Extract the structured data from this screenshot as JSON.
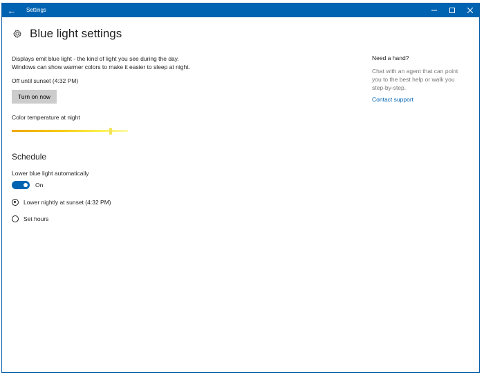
{
  "window": {
    "title": "Settings",
    "back_icon": "arrow-left-icon",
    "controls": [
      "minimize-icon",
      "maximize-icon",
      "close-icon"
    ]
  },
  "header": {
    "icon": "gear-icon",
    "title": "Blue light settings"
  },
  "main": {
    "description": "Displays emit blue light - the kind of light you see during the day. Windows can show warmer colors to make it easier to sleep at night.",
    "status": "Off until sunset (4:32 PM)",
    "turn_on_button": "Turn on now",
    "color_temperature_label": "Color temperature at night",
    "color_temperature_level": 0.85,
    "schedule": {
      "title": "Schedule",
      "auto_label": "Lower blue light automatically",
      "toggle_state": "On",
      "toggle_on": true,
      "options": [
        {
          "label": "Lower nightly at sunset (4:32 PM)",
          "selected": true
        },
        {
          "label": "Set hours",
          "selected": false
        }
      ]
    }
  },
  "help": {
    "title": "Need a hand?",
    "text": "Chat with an agent that can point you to the best help or walk you step-by-step.",
    "link": "Contact support"
  },
  "colors": {
    "accent": "#0063b1",
    "button_bg": "#cccccc",
    "muted_text": "#767676"
  }
}
